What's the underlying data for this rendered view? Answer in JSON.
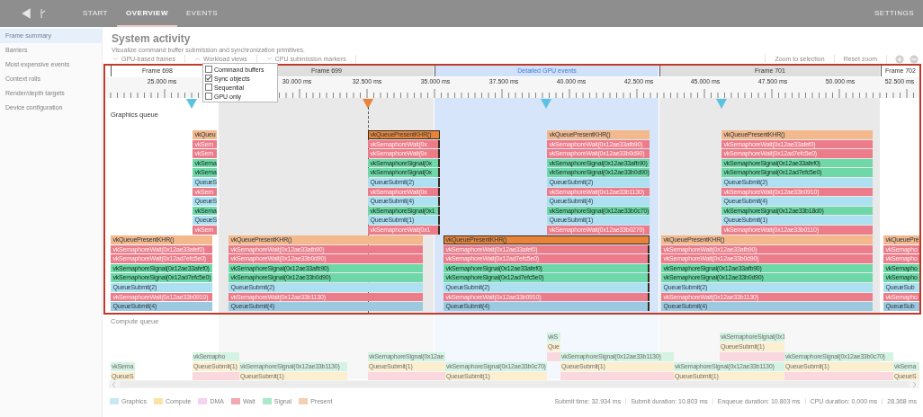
{
  "top_bar": {
    "tabs": [
      {
        "label": "START",
        "selected": false
      },
      {
        "label": "OVERVIEW",
        "selected": true
      },
      {
        "label": "EVENTS",
        "selected": false
      }
    ],
    "settings": "SETTINGS"
  },
  "sidebar": {
    "items": [
      {
        "label": "Frame summary",
        "selected": true
      },
      {
        "label": "Barriers",
        "selected": false
      },
      {
        "label": "Most expensive events",
        "selected": false
      },
      {
        "label": "Context rolls",
        "selected": false
      },
      {
        "label": "Render/depth targets",
        "selected": false
      },
      {
        "label": "Device configuration",
        "selected": false
      }
    ]
  },
  "title": "System activity",
  "subtitle": "Visualize command buffer submission and synchronization primitives.",
  "sections": [
    {
      "label": "GPU-based frames",
      "expanded": false
    },
    {
      "label": "Workload views",
      "expanded": true
    },
    {
      "label": "CPU submission markers",
      "expanded": false
    }
  ],
  "toolbar": {
    "zoom_to_selection": "Zoom to selection",
    "reset_zoom": "Reset zoom"
  },
  "workload_options": [
    {
      "label": "Command buffers",
      "checked": false
    },
    {
      "label": "Sync objects",
      "checked": true
    },
    {
      "label": "Sequential",
      "checked": false
    },
    {
      "label": "GPU only",
      "checked": false
    }
  ],
  "frames": [
    {
      "label": "Frame 698",
      "kind": "frame",
      "shaded": false
    },
    {
      "label": "Frame 699",
      "kind": "frame",
      "shaded": true
    },
    {
      "label": "Detailed GPU events",
      "kind": "detail"
    },
    {
      "label": "Frame 701",
      "kind": "frame",
      "shaded": true
    },
    {
      "label": "Frame 702",
      "kind": "frame",
      "shaded": false
    }
  ],
  "ticks": [
    "25.000 ms",
    "30.000 ms",
    "32.500 ms",
    "35.000 ms",
    "37.500 ms",
    "40.000 ms",
    "42.500 ms",
    "45.000 ms",
    "47.500 ms",
    "50.000 ms",
    "52.500 ms"
  ],
  "markers": [
    {
      "color": "#5bc3e0"
    },
    {
      "color": "#e8843a"
    },
    {
      "color": "#5bc3e0"
    },
    {
      "color": "#5bc3e0"
    }
  ],
  "graphics_queue": {
    "label": "Graphics queue",
    "bursts": [
      {
        "selected": false,
        "events": [
          {
            "kind": "present",
            "label": "vkQueu"
          },
          {
            "kind": "wait",
            "label": "vkSem"
          },
          {
            "kind": "wait",
            "label": "vkSem"
          },
          {
            "kind": "signal",
            "label": "vkSema"
          },
          {
            "kind": "signal",
            "label": "vkSema"
          },
          {
            "kind": "submit",
            "label": "QueueS"
          },
          {
            "kind": "wait",
            "label": "vkSem"
          },
          {
            "kind": "submit",
            "label": "QueueS"
          },
          {
            "kind": "signal",
            "label": "vkSema"
          },
          {
            "kind": "submit",
            "label": "QueueS"
          },
          {
            "kind": "wait",
            "label": "vkSem"
          }
        ]
      },
      {
        "selected": true,
        "events": [
          {
            "kind": "present",
            "label": "vkQueuePresentKHR()"
          },
          {
            "kind": "wait",
            "label": "vkSemaphoreWait(0x"
          },
          {
            "kind": "wait",
            "label": "vkSemaphoreWait(0x"
          },
          {
            "kind": "signal",
            "label": "vkSemaphoreSignal(0x"
          },
          {
            "kind": "signal",
            "label": "vkSemaphoreSignal(0x"
          },
          {
            "kind": "submit",
            "label": "QueueSubmit(2)"
          },
          {
            "kind": "wait",
            "label": "vkSemaphoreWait(0x"
          },
          {
            "kind": "submit",
            "label": "QueueSubmit(4)"
          },
          {
            "kind": "signal",
            "label": "vkSemaphoreSignal(0x1"
          },
          {
            "kind": "submit",
            "label": "QueueSubmit(1)"
          },
          {
            "kind": "wait",
            "label": "vkSemaphoreWait(0x1"
          }
        ]
      },
      {
        "selected": false,
        "events": [
          {
            "kind": "present",
            "label": "vkQueuePresentKHR()"
          },
          {
            "kind": "wait",
            "label": "vkSemaphoreWait(0x12ae33afb90)"
          },
          {
            "kind": "wait",
            "label": "vkSemaphoreWait(0x12ae33b0d90)"
          },
          {
            "kind": "signal",
            "label": "vkSemaphoreSignal(0x12ae33afb90)"
          },
          {
            "kind": "signal",
            "label": "vkSemaphoreSignal(0x12ae33b0d90)"
          },
          {
            "kind": "submit",
            "label": "QueueSubmit(2)"
          },
          {
            "kind": "wait",
            "label": "vkSemaphoreWait(0x12ae33b1130)"
          },
          {
            "kind": "submit",
            "label": "QueueSubmit(4)"
          },
          {
            "kind": "signal",
            "label": "vkSemaphoreSignal(0x12ae33b0c70)"
          },
          {
            "kind": "submit",
            "label": "QueueSubmit(1)"
          },
          {
            "kind": "wait",
            "label": "vkSemaphoreWait(0x12ae33b0270)"
          }
        ]
      },
      {
        "selected": false,
        "events": [
          {
            "kind": "present",
            "label": "vkQueuePresentKHR()"
          },
          {
            "kind": "wait",
            "label": "vkSemaphoreWait(0x12ae33afef0)"
          },
          {
            "kind": "wait",
            "label": "vkSemaphoreWait(0x12ad7efc5e0)"
          },
          {
            "kind": "signal",
            "label": "vkSemaphoreSignal(0x12ae33afef0)"
          },
          {
            "kind": "signal",
            "label": "vkSemaphoreSignal(0x12ad7efc5e0)"
          },
          {
            "kind": "submit",
            "label": "QueueSubmit(2)"
          },
          {
            "kind": "wait",
            "label": "vkSemaphoreWait(0x12ae33b0910)"
          },
          {
            "kind": "submit",
            "label": "QueueSubmit(4)"
          },
          {
            "kind": "signal",
            "label": "vkSemaphoreSignal(0x12ae33b18d0)"
          },
          {
            "kind": "submit",
            "label": "QueueSubmit(1)"
          },
          {
            "kind": "wait",
            "label": "vkSemaphoreWait(0x12ae33b0110)"
          }
        ]
      },
      {
        "selected": false,
        "events": [
          {
            "kind": "present",
            "label": "vkQueuePresentKHR()"
          },
          {
            "kind": "wait",
            "label": "vkSemaphoreWait(0x12ae33afef0)"
          },
          {
            "kind": "wait",
            "label": "vkSemaphoreWait(0x12ad7efc5e0)"
          },
          {
            "kind": "signal",
            "label": "vkSemaphoreSignal(0x12ae33afef0)"
          },
          {
            "kind": "signal",
            "label": "vkSemaphoreSignal(0x12ad7efc5e0)"
          },
          {
            "kind": "submit",
            "label": "QueueSubmit(2)"
          },
          {
            "kind": "wait",
            "label": "vkSemaphoreWait(0x12ae33b0910)"
          },
          {
            "kind": "submit",
            "label": "QueueSubmit(4)"
          }
        ]
      },
      {
        "selected": false,
        "events": [
          {
            "kind": "present",
            "label": "vkQueuePresentKHR()"
          },
          {
            "kind": "wait",
            "label": "vkSemaphoreWait(0x12ae33afb90)"
          },
          {
            "kind": "wait",
            "label": "vkSemaphoreWait(0x12ae33b0d90)"
          },
          {
            "kind": "signal",
            "label": "vkSemaphoreSignal(0x12ae33afb90)"
          },
          {
            "kind": "signal",
            "label": "vkSemaphoreSignal(0x12ae33b0d90)"
          },
          {
            "kind": "submit",
            "label": "QueueSubmit(2)"
          },
          {
            "kind": "wait",
            "label": "vkSemaphoreWait(0x12ae33b1130)"
          },
          {
            "kind": "submit",
            "label": "QueueSubmit(4)"
          }
        ]
      },
      {
        "selected": true,
        "events": [
          {
            "kind": "present",
            "label": "vkQueuePresentKHR()"
          },
          {
            "kind": "wait",
            "label": "vkSemaphoreWait(0x12ae33afef0)"
          },
          {
            "kind": "wait",
            "label": "vkSemaphoreWait(0x12ad7efc5e0)"
          },
          {
            "kind": "signal",
            "label": "vkSemaphoreSignal(0x12ae33afef0)"
          },
          {
            "kind": "signal",
            "label": "vkSemaphoreSignal(0x12ad7efc5e0)"
          },
          {
            "kind": "submit",
            "label": "QueueSubmit(2)"
          },
          {
            "kind": "wait",
            "label": "vkSemaphoreWait(0x12ae33b0910)"
          },
          {
            "kind": "submit",
            "label": "QueueSubmit(4)"
          }
        ]
      },
      {
        "selected": false,
        "events": [
          {
            "kind": "present",
            "label": "vkQueuePresentKHR()"
          },
          {
            "kind": "wait",
            "label": "vkSemaphoreWait(0x12ae33afb90)"
          },
          {
            "kind": "wait",
            "label": "vkSemaphoreWait(0x12ae33b0d90)"
          },
          {
            "kind": "signal",
            "label": "vkSemaphoreSignal(0x12ae33afb90)"
          },
          {
            "kind": "signal",
            "label": "vkSemaphoreSignal(0x12ae33b0d90)"
          },
          {
            "kind": "submit",
            "label": "QueueSubmit(2)"
          },
          {
            "kind": "wait",
            "label": "vkSemaphoreWait(0x12ae33b1130)"
          },
          {
            "kind": "submit",
            "label": "QueueSubmit(4)"
          }
        ]
      },
      {
        "selected": false,
        "events": [
          {
            "kind": "present",
            "label": "vkQueuePre"
          },
          {
            "kind": "wait",
            "label": "vkSemapho"
          },
          {
            "kind": "wait",
            "label": "vkSemapho"
          },
          {
            "kind": "signal",
            "label": "vkSemapho"
          },
          {
            "kind": "signal",
            "label": "vkSemapho"
          },
          {
            "kind": "submit",
            "label": "QueueSub"
          },
          {
            "kind": "wait",
            "label": "vkSemapho"
          },
          {
            "kind": "submit",
            "label": "QueueSub"
          }
        ]
      }
    ]
  },
  "compute_queue": {
    "label": "Compute queue",
    "bursts": [
      {
        "events": [
          {
            "kind": "signal",
            "label": "vkSema"
          },
          {
            "kind": "compute",
            "label": "QueueS"
          }
        ]
      },
      {
        "events": [
          {
            "kind": "signal",
            "label": "vkSemapho"
          },
          {
            "kind": "compute",
            "label": "QueueSubmit(1)"
          },
          {
            "kind": "wait"
          }
        ]
      },
      {
        "events": [
          {
            "kind": "signal",
            "label": "vkSemaphoreSignal(0x12ae33b1130)"
          },
          {
            "kind": "compute",
            "label": "QueueSubmit(1)"
          }
        ]
      },
      {
        "events": [
          {
            "kind": "signal",
            "label": "vkSemaphoreSignal(0x12ae"
          },
          {
            "kind": "compute",
            "label": "QueueSubmit(1)"
          },
          {
            "kind": "wait"
          }
        ]
      },
      {
        "events": [
          {
            "kind": "signal",
            "label": "vkSemaphoreSignal(0x12ae33b0c70)"
          },
          {
            "kind": "compute",
            "label": "QueueSubmit(1)"
          }
        ]
      },
      {
        "events": [
          {
            "kind": "signal",
            "label": "vkS"
          },
          {
            "kind": "compute",
            "label": "Que"
          },
          {
            "kind": "wait"
          }
        ]
      },
      {
        "events": [
          {
            "kind": "signal",
            "label": "vkSemaphoreSignal(0x12ae33b1130)"
          },
          {
            "kind": "compute",
            "label": "QueueSubmit(1)"
          },
          {
            "kind": "wait"
          }
        ]
      },
      {
        "events": [
          {
            "kind": "signal",
            "label": "vkSemaphoreSignal(0x1"
          },
          {
            "kind": "compute",
            "label": "QueueSubmit(1)"
          },
          {
            "kind": "wait"
          }
        ]
      },
      {
        "events": [
          {
            "kind": "signal",
            "label": "vkSemaphoreSignal(0x12ae33b1130)"
          },
          {
            "kind": "compute",
            "label": "QueueSubmit(1)"
          }
        ]
      },
      {
        "events": [
          {
            "kind": "signal",
            "label": "vkSemaphoreSignal(0x12ae33b0c70)"
          },
          {
            "kind": "compute",
            "label": "QueueSubmit(1)"
          },
          {
            "kind": "wait"
          }
        ]
      },
      {
        "events": [
          {
            "kind": "signal",
            "label": "vkSema"
          },
          {
            "kind": "compute",
            "label": "QueueS"
          }
        ]
      }
    ]
  },
  "legend": [
    {
      "label": "Graphics",
      "color": "#c8e8f6"
    },
    {
      "label": "Compute",
      "color": "#fbe3a4"
    },
    {
      "label": "DMA",
      "color": "#f6d3f3"
    },
    {
      "label": "Wait",
      "color": "#f3a7b0"
    },
    {
      "label": "Signal",
      "color": "#a9e8c8"
    },
    {
      "label": "Present",
      "color": "#f6cfae"
    }
  ],
  "status_bar": [
    "Submit time: 32.934 ms",
    "Submit duration: 10.803 ms",
    "Enqueue duration: 10.803 ms",
    "CPU duration: 0.000 ms",
    "28.368 ms"
  ]
}
